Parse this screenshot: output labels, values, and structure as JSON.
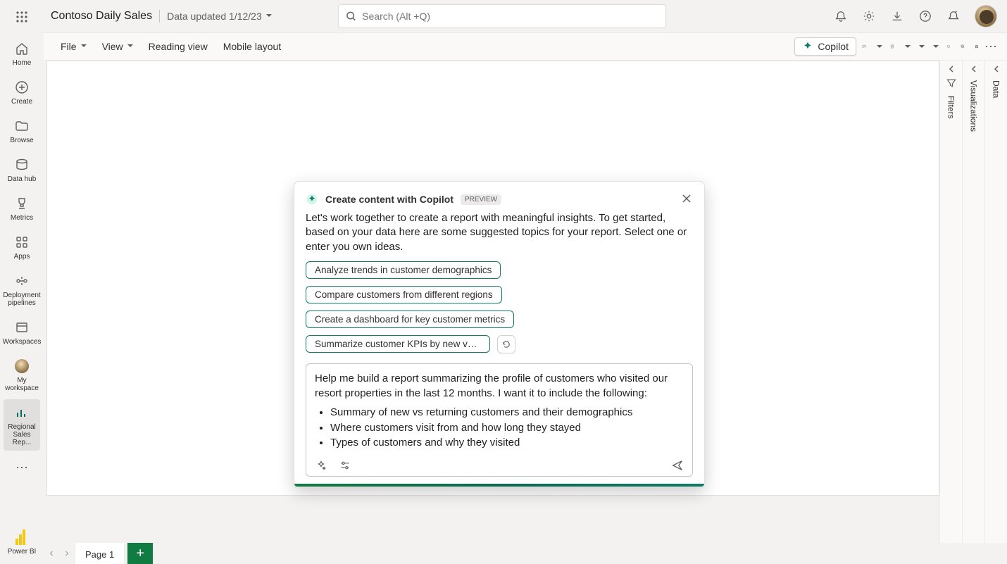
{
  "header": {
    "title": "Contoso Daily Sales",
    "subtitle": "Data updated 1/12/23",
    "search_placeholder": "Search (Alt +Q)"
  },
  "toolbar": {
    "file": "File",
    "view": "View",
    "reading_view": "Reading view",
    "mobile_layout": "Mobile layout",
    "copilot": "Copilot"
  },
  "rail": {
    "home": "Home",
    "create": "Create",
    "browse": "Browse",
    "data_hub": "Data hub",
    "metrics": "Metrics",
    "apps": "Apps",
    "deployment": "Deployment pipelines",
    "workspaces": "Workspaces",
    "my_workspace": "My workspace",
    "regional": "Regional Sales Rep...",
    "powerbi": "Power BI"
  },
  "panes": {
    "filters": "Filters",
    "visualizations": "Visualizations",
    "data": "Data"
  },
  "pagebar": {
    "page1": "Page 1"
  },
  "dialog": {
    "title": "Create content with Copilot",
    "badge": "PREVIEW",
    "intro": "Let's work together to create a report with meaningful insights. To get started, based on your data here are some suggested topics for your report. Select one or enter you own ideas.",
    "chips": [
      "Analyze trends in customer demographics",
      "Compare customers from different regions",
      "Create a dashboard for key customer metrics",
      "Summarize customer KPIs by new vs returning c..."
    ],
    "prompt_lead": "Help me build a report summarizing the profile of customers who visited our resort properties in the last 12 months. I want it to include the following:",
    "bullets": [
      "Summary of new vs returning customers and their demographics",
      "Where customers visit from and how long they stayed",
      "Types of customers and why they visited"
    ]
  }
}
